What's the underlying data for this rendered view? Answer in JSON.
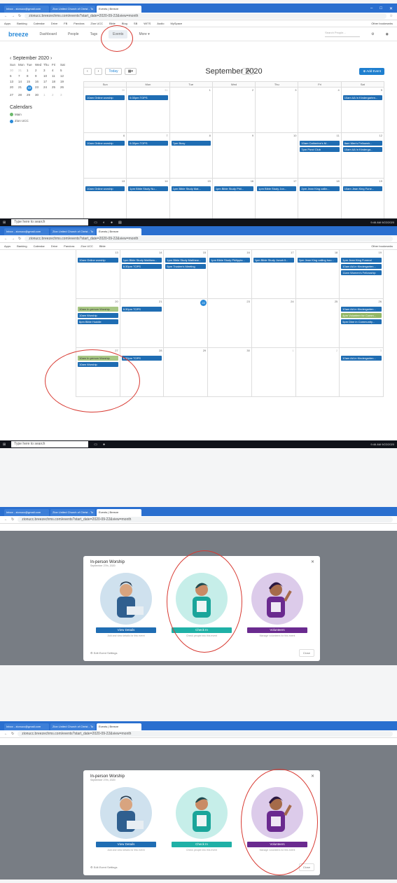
{
  "browser": {
    "tabs": [
      "Inbox - zionucc@gmail.com",
      "Zion United Church of Christ - To",
      "Events | Breeze"
    ],
    "url": "zionucc.breezechms.com/events?start_date=2020-09-22&view=month",
    "bookmarks": [
      "Apps",
      "Banking",
      "Calendar",
      "Drive",
      "FB",
      "Pandora",
      "Zion UCC",
      "Bible",
      "Blog",
      "SB",
      "WITS",
      "Audio",
      "MySpace",
      "musy",
      "Shapes",
      "Uke",
      "sharehelo",
      "Other bookmarks"
    ],
    "taskbar_search": "Type here to search",
    "time": "9:46 AM",
    "date": "9/22/2020"
  },
  "breeze": {
    "logo": "breeze",
    "nav": [
      "Dashboard",
      "People",
      "Tags",
      "Events",
      "More ▾"
    ],
    "search_placeholder": "Search People..."
  },
  "mini_cal": {
    "title": "‹  September 2020  ›",
    "dows": [
      "Sun",
      "Mon",
      "Tue",
      "Wed",
      "Thu",
      "Fri",
      "Sat"
    ],
    "days": [
      "30",
      "31",
      "1",
      "2",
      "3",
      "4",
      "5",
      "6",
      "7",
      "8",
      "9",
      "10",
      "11",
      "12",
      "13",
      "14",
      "15",
      "16",
      "17",
      "18",
      "19",
      "20",
      "21",
      "22",
      "23",
      "24",
      "25",
      "26",
      "27",
      "28",
      "29",
      "30",
      "1",
      "2",
      "3"
    ],
    "calendars_title": "Calendars",
    "calendars": [
      "Main",
      "Zion UCC"
    ]
  },
  "toolbar": {
    "today": "Today",
    "month": "September 2020",
    "add": "Add Event"
  },
  "cal_head": [
    "Sun",
    "Mon",
    "Tue",
    "Wed",
    "Thu",
    "Fri",
    "Sat"
  ],
  "weeks1": [
    {
      "days": [
        "30",
        "31",
        "1",
        "2",
        "3",
        "4",
        "5"
      ],
      "events": [
        [
          "10am  Online worship"
        ],
        [
          "6:30pm  TOPS"
        ],
        [],
        [],
        [],
        [],
        [
          "10am  AA in Kindergarten..."
        ]
      ]
    },
    {
      "days": [
        "6",
        "7",
        "8",
        "9",
        "10",
        "11",
        "12"
      ],
      "events": [
        [
          "10am  Online worship"
        ],
        [
          "6:30pm  TOPS"
        ],
        [
          "7pm  Busy"
        ],
        [],
        [],
        [
          "10am  Catherine's M...",
          "7pm  Pond Club"
        ],
        [
          "8am  Men's Fellowsh...",
          "10am  AA in Kinderga..."
        ]
      ]
    },
    {
      "days": [
        "13",
        "14",
        "15",
        "16",
        "17",
        "18",
        "19"
      ],
      "events": [
        [
          "10am  Online worship"
        ],
        [
          "1pm  Bible Study Nu..."
        ],
        [
          "1pm  Bible Study Mat..."
        ],
        [
          "1pm  Bible Study Phil..."
        ],
        [
          "1pm  Bible Study Jon..."
        ],
        [
          "2pm  Jean King callin..."
        ],
        [
          "10am  Jean King Fune..."
        ]
      ]
    }
  ],
  "weeks2": [
    {
      "days": [
        "13",
        "14",
        "15",
        "16",
        "17",
        "18",
        "19"
      ],
      "events": [
        [
          "10am  Online worship"
        ],
        [
          "1pm  Bible Study Matthew...",
          "6:30pm  TOPS"
        ],
        [
          "1pm  Bible Study Matthew...",
          "6pm  Trustee's Meeting"
        ],
        [
          "1pm  Bible Study Philippia..."
        ],
        [
          "1pm  Bible Study Jonah ll..."
        ],
        [
          "2pm  Jean King calling hou..."
        ],
        [
          "1pm  Jean King Funeral",
          "10am  AA in Kindergarten...",
          "11am  Women's Fellowship"
        ]
      ]
    },
    {
      "days": [
        "20",
        "21",
        "22",
        "23",
        "24",
        "25",
        "26"
      ],
      "events": [
        [
          "10am  In-person Worship",
          "10am  Worship",
          "6pm  Bible Huddle"
        ],
        [
          "6:30pm  TOPS"
        ],
        [],
        [],
        [],
        [],
        [
          "10am  AA in Kindergarten...",
          "4pm  Volunteer for Comm...",
          "5pm  Dine in Community..."
        ]
      ]
    },
    {
      "days": [
        "27",
        "28",
        "29",
        "30",
        "1",
        "2",
        "3"
      ],
      "events": [
        [
          "10am  In-person Worship",
          "10am  Worship"
        ],
        [
          "6:30pm  TOPS"
        ],
        [],
        [],
        [],
        [],
        [
          "10am  AA in Kindergarten..."
        ]
      ]
    }
  ],
  "modal": {
    "title": "In-person Worship",
    "subtitle": "September 27th, 2020",
    "cards": [
      {
        "button": "View Details",
        "caption": "Add and view details for this event",
        "color": "#1f6db3"
      },
      {
        "button": "Check In",
        "caption": "Check people into this event",
        "color": "#1fb0a6"
      },
      {
        "button": "Volunteers",
        "caption": "Manage volunteers for this event",
        "color": "#6a2a8f"
      }
    ],
    "settings": "Edit Event Settings",
    "close": "Close"
  }
}
